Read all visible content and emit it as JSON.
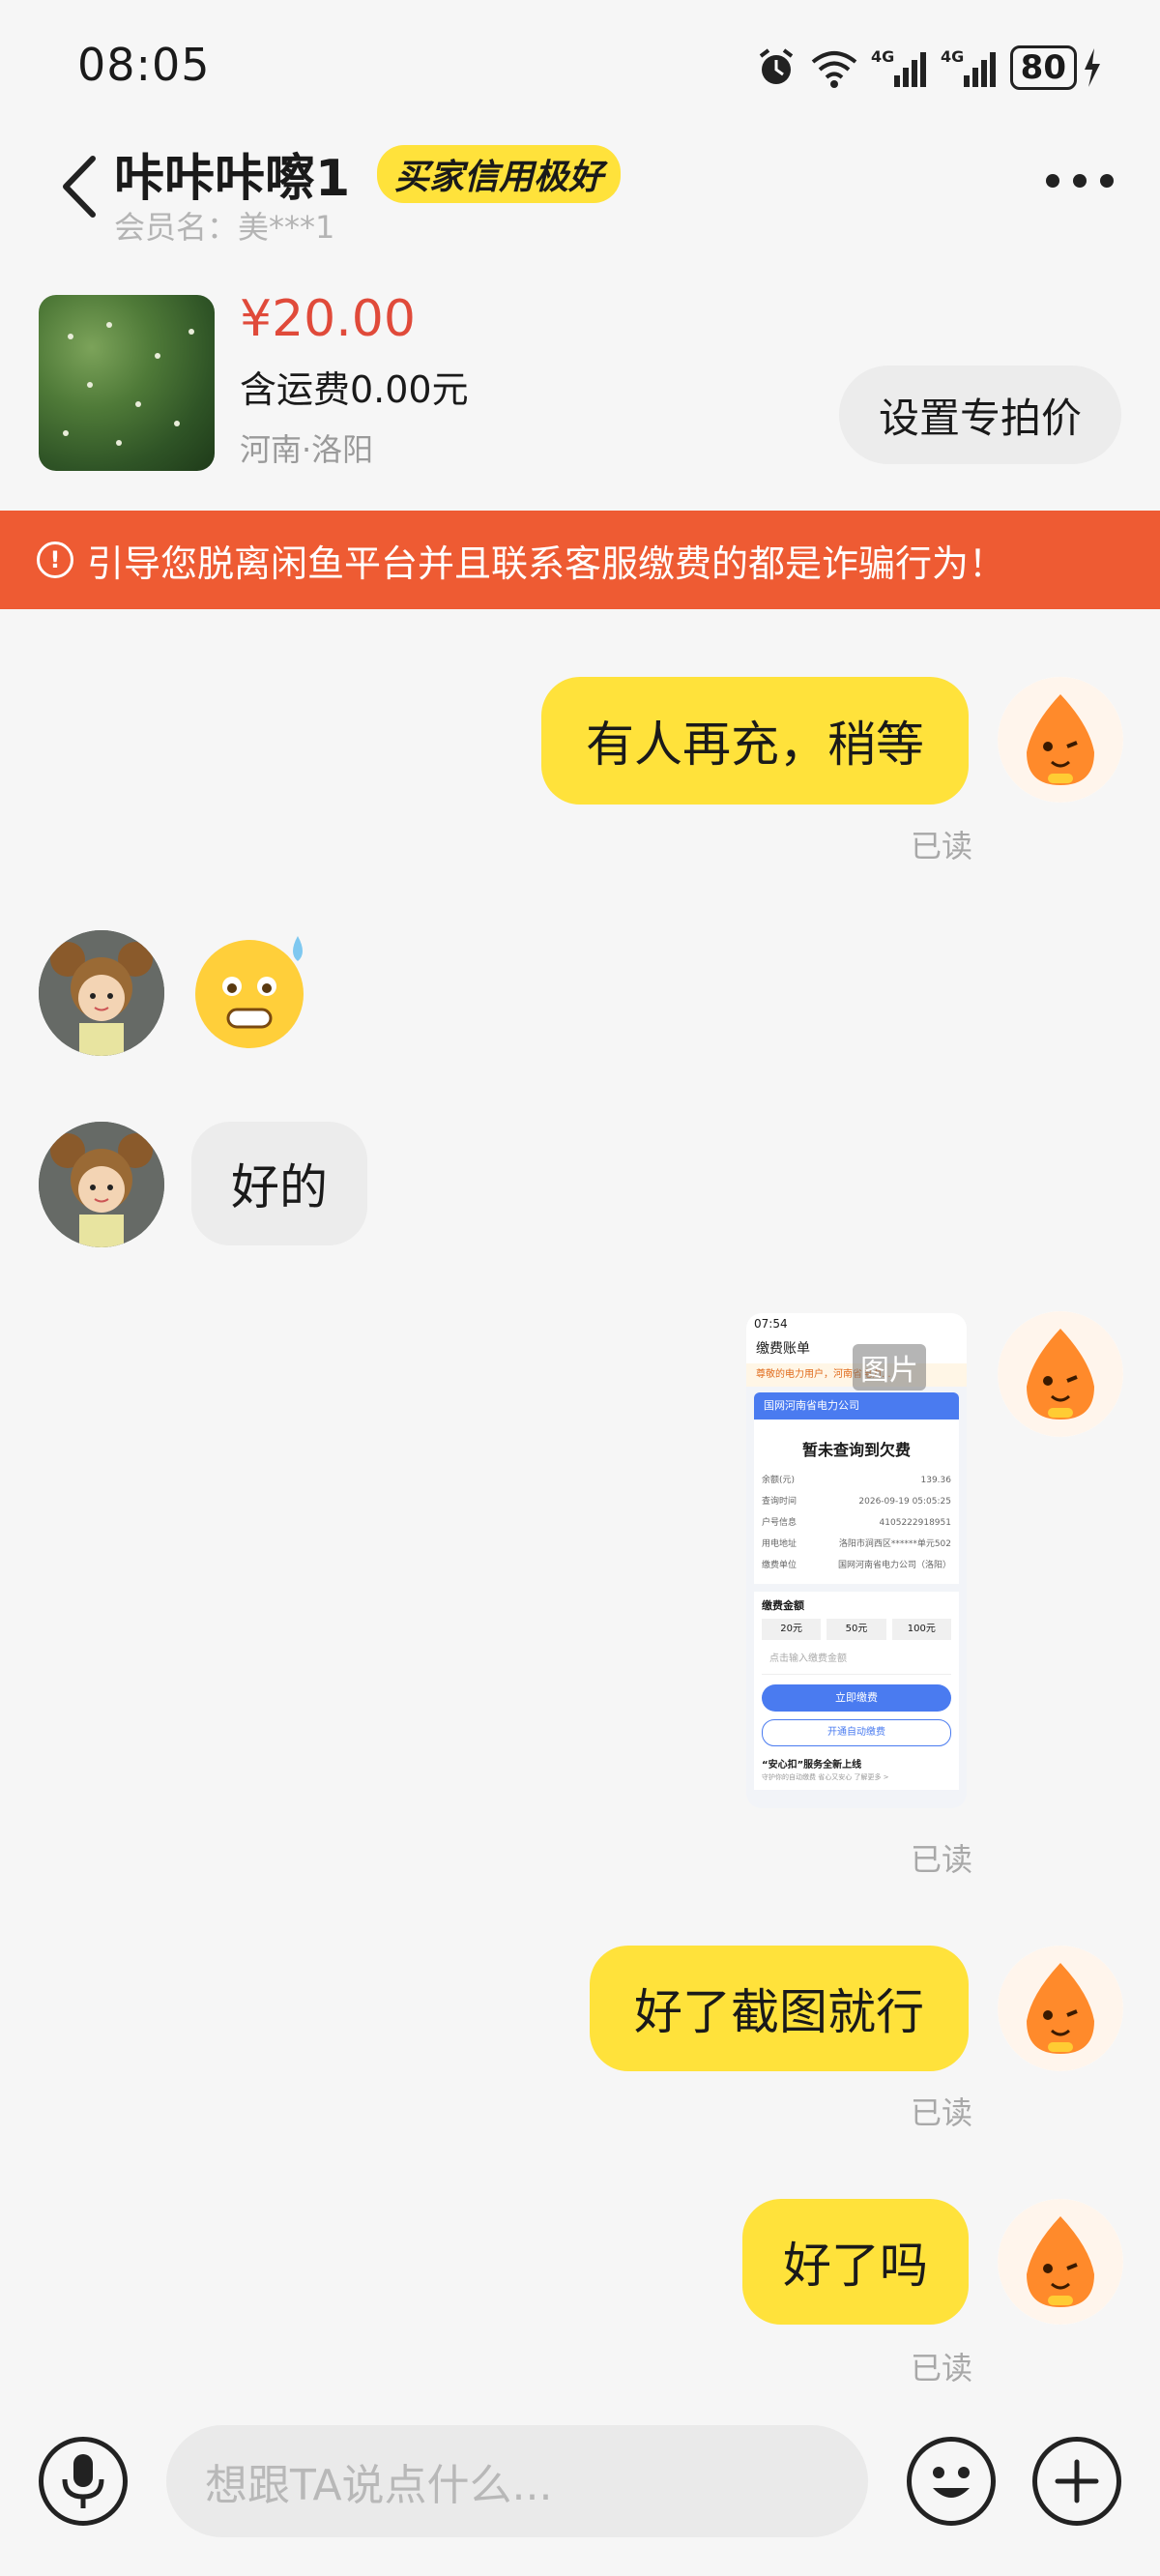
{
  "status_bar": {
    "time": "08:05",
    "battery": "80"
  },
  "header": {
    "title": "咔咔咔嚓1",
    "badge": "买家信用极好",
    "member": "会员名：美***1"
  },
  "product": {
    "price": "¥20.00",
    "shipping": "含运费0.00元",
    "location": "河南·洛阳",
    "set_price_button": "设置专拍价"
  },
  "warning": {
    "text": "引导您脱离闲鱼平台并且联系客服缴费的都是诈骗行为！"
  },
  "messages": [
    {
      "from": "me",
      "text": "有人再充，稍等",
      "status": "已读"
    },
    {
      "from": "other",
      "type": "emoji",
      "text": "😅"
    },
    {
      "from": "other",
      "text": "好的"
    },
    {
      "from": "me",
      "type": "image",
      "tag": "图片",
      "status": "已读"
    },
    {
      "from": "me",
      "text": "好了截图就行",
      "status": "已读"
    },
    {
      "from": "me",
      "text": "好了吗",
      "status": "已读"
    }
  ],
  "screenshot": {
    "time": "07:54",
    "header": "缴费账单",
    "notice": "尊敬的电力用户，河南省电力...",
    "company": "国网河南省电力公司",
    "status_title": "暂未查询到欠费",
    "rows": [
      {
        "label": "余额(元)",
        "value": "139.36"
      },
      {
        "label": "查询时间",
        "value": "2026-09-19 05:05:25"
      },
      {
        "label": "户号信息",
        "value": "4105222918951"
      },
      {
        "label": "用电地址",
        "value": "洛阳市涧西区******单元502"
      },
      {
        "label": "缴费单位",
        "value": "国网河南省电力公司（洛阳）"
      }
    ],
    "amount_title": "缴费金额",
    "amounts": [
      "20元",
      "50元",
      "100元"
    ],
    "amount_placeholder": "点击输入缴费金额",
    "pay_button": "立即缴费",
    "auto_button": "开通自动缴费",
    "promo": "“安心扣”服务全新上线",
    "promo_sub": "守护你的自动缴费 省心又安心 了解更多 >"
  },
  "input": {
    "placeholder": "想跟TA说点什么..."
  },
  "colors": {
    "accent_yellow": "#ffe23b",
    "warning_orange": "#ee5b33",
    "price_red": "#e04a3a"
  }
}
